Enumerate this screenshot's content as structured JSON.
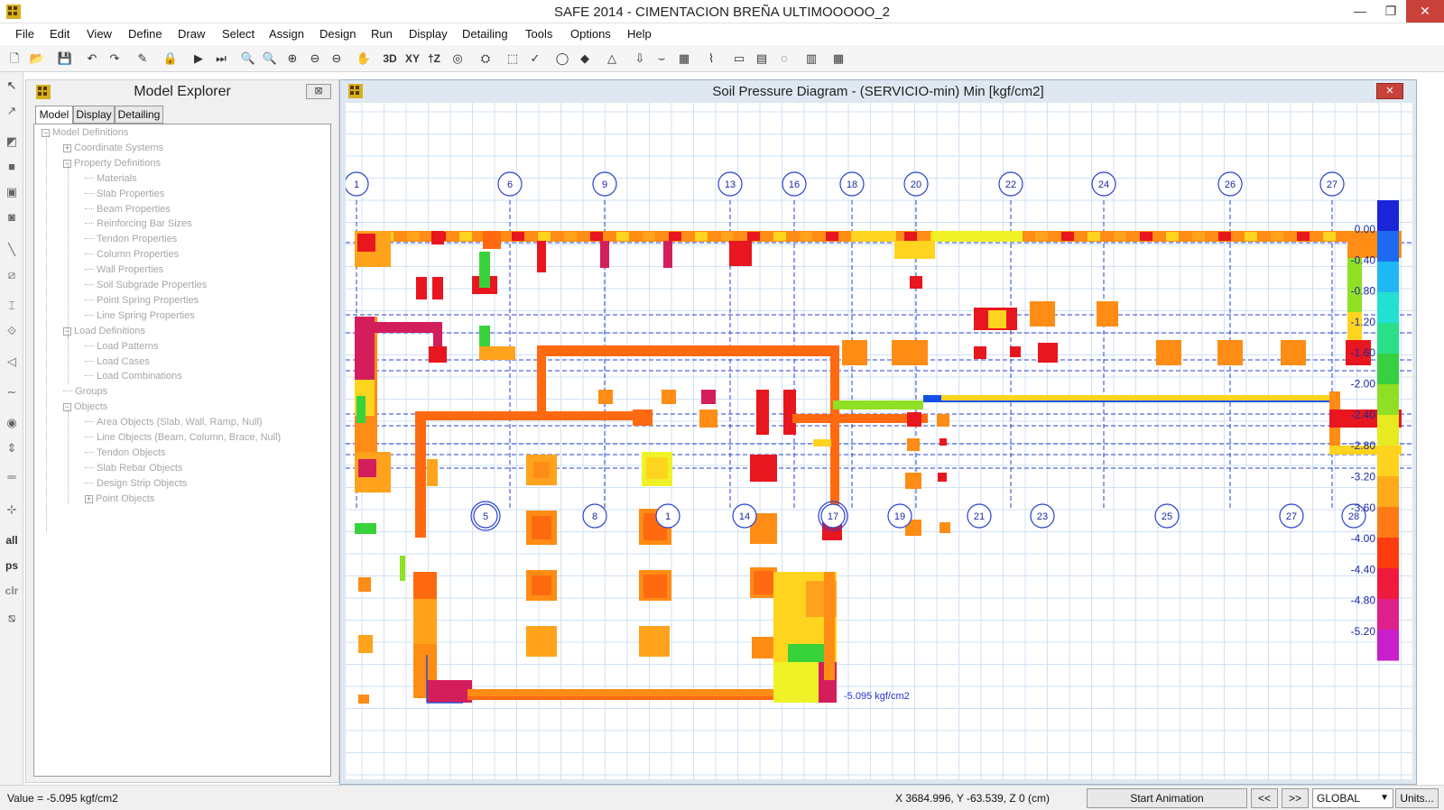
{
  "window": {
    "title": "SAFE 2014 - CIMENTACION BREÑA ULTIMOOOOO_2",
    "minimize_glyph": "—",
    "maximize_glyph": "❐",
    "close_glyph": "✕"
  },
  "menu": [
    "File",
    "Edit",
    "View",
    "Define",
    "Draw",
    "Select",
    "Assign",
    "Design",
    "Run",
    "Display",
    "Detailing",
    "Tools",
    "Options",
    "Help"
  ],
  "toolbar": {
    "icons": [
      "new-file-icon",
      "open-file-icon",
      "save-icon",
      "undo-icon",
      "redo-icon",
      "pencil-icon",
      "lock-icon",
      "run-icon",
      "run-check-icon",
      "zoom-window-icon",
      "zoom-restore-icon",
      "zoom-in-icon",
      "zoom-out-icon",
      "zoom-previous-icon",
      "pan-icon",
      "view-3d",
      "view-xy",
      "view-elevation",
      "rotate-icon",
      "perspective-icon",
      "select-icon",
      "check-icon",
      "object-shrink-icon",
      "refresh-icon",
      "deformed-shape-icon",
      "show-loads-icon",
      "forces-icon",
      "design-icon",
      "strip-forces-icon",
      "slab-forces-icon",
      "beam-forces-icon",
      "display-tables-icon",
      "grid-icon",
      "table-icon"
    ],
    "text_buttons": [
      "3D",
      "XY",
      "†Z"
    ]
  },
  "left_tools": {
    "all_label": "all",
    "ps_label": "ps",
    "clr_label": "clr"
  },
  "explorer": {
    "title": "Model Explorer",
    "close_glyph": "⊠",
    "tabs": [
      "Model",
      "Display",
      "Detailing"
    ],
    "active_tab": "Model",
    "tree": [
      {
        "label": "Model Definitions",
        "level": 0,
        "toggle": "−"
      },
      {
        "label": "Coordinate Systems",
        "level": 1,
        "toggle": "+"
      },
      {
        "label": "Property Definitions",
        "level": 1,
        "toggle": "−"
      },
      {
        "label": "Materials",
        "level": 2,
        "toggle": ""
      },
      {
        "label": "Slab Properties",
        "level": 2,
        "toggle": ""
      },
      {
        "label": "Beam Properties",
        "level": 2,
        "toggle": ""
      },
      {
        "label": "Reinforcing Bar Sizes",
        "level": 2,
        "toggle": ""
      },
      {
        "label": "Tendon Properties",
        "level": 2,
        "toggle": ""
      },
      {
        "label": "Column Properties",
        "level": 2,
        "toggle": ""
      },
      {
        "label": "Wall Properties",
        "level": 2,
        "toggle": ""
      },
      {
        "label": "Soil Subgrade Properties",
        "level": 2,
        "toggle": ""
      },
      {
        "label": "Point Spring Properties",
        "level": 2,
        "toggle": ""
      },
      {
        "label": "Line Spring Properties",
        "level": 2,
        "toggle": ""
      },
      {
        "label": "Load Definitions",
        "level": 1,
        "toggle": "−"
      },
      {
        "label": "Load Patterns",
        "level": 2,
        "toggle": ""
      },
      {
        "label": "Load Cases",
        "level": 2,
        "toggle": ""
      },
      {
        "label": "Load Combinations",
        "level": 2,
        "toggle": ""
      },
      {
        "label": "Groups",
        "level": 1,
        "toggle": ""
      },
      {
        "label": "Objects",
        "level": 1,
        "toggle": "−"
      },
      {
        "label": "Area Objects (Slab, Wall, Ramp, Null)",
        "level": 2,
        "toggle": ""
      },
      {
        "label": "Line Objects (Beam, Column, Brace, Null)",
        "level": 2,
        "toggle": ""
      },
      {
        "label": "Tendon Objects",
        "level": 2,
        "toggle": ""
      },
      {
        "label": "Slab Rebar Objects",
        "level": 2,
        "toggle": ""
      },
      {
        "label": "Design Strip Objects",
        "level": 2,
        "toggle": ""
      },
      {
        "label": "Point Objects",
        "level": 2,
        "toggle": "+"
      }
    ]
  },
  "plot": {
    "title": "Soil Pressure Diagram - (SERVICIO-min)  Min  [kgf/cm2]",
    "close_glyph": "✕",
    "top_grid_labels": [
      "1",
      "6",
      "9",
      "13",
      "16",
      "18",
      "20",
      "22",
      "24",
      "26",
      "27"
    ],
    "bottom_grid_labels": [
      "5",
      "8",
      "1",
      "14",
      "17",
      "19",
      "21",
      "23",
      "25",
      "27",
      "28"
    ],
    "annotation": "-5.095 kgf/cm2",
    "legend": {
      "labels": [
        "0.00",
        "-0.40",
        "-0.80",
        "-1.20",
        "-1.60",
        "-2.00",
        "-2.40",
        "-2.80",
        "-3.20",
        "-3.60",
        "-4.00",
        "-4.40",
        "-4.80",
        "-5.20"
      ],
      "colors": [
        "#1a24d8",
        "#1d6af0",
        "#20b8f2",
        "#22e0d2",
        "#27e088",
        "#36d040",
        "#8fe024",
        "#e6ea1e",
        "#ffd21e",
        "#ffaa1a",
        "#ff7a14",
        "#ff3c10",
        "#f01a3c",
        "#e0208a",
        "#c81ecc"
      ],
      "min": 0.0,
      "max": -5.2,
      "step": -0.4
    }
  },
  "status": {
    "value": "Value = -5.095 kgf/cm2",
    "coords": "X 3684.996,  Y -63.539,  Z 0   (cm)",
    "start_animation": "Start Animation",
    "prev": "<<",
    "next": ">>",
    "coord_system": "GLOBAL",
    "units": "Units..."
  }
}
